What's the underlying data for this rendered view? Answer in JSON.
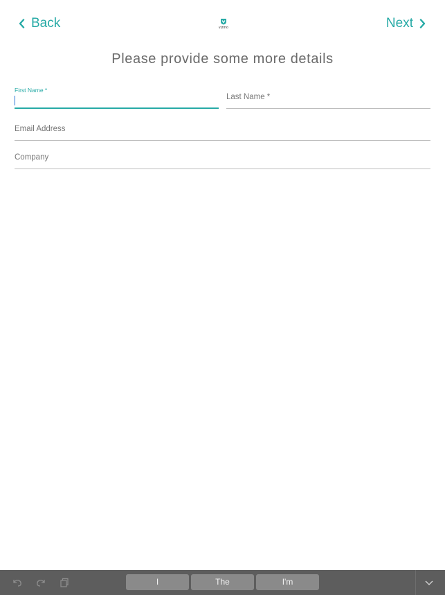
{
  "nav": {
    "back_label": "Back",
    "next_label": "Next",
    "logo_text": "vizmo"
  },
  "page": {
    "title": "Please provide some more details"
  },
  "form": {
    "first_name": {
      "label": "First Name *",
      "value": ""
    },
    "last_name": {
      "placeholder": "Last Name *",
      "value": ""
    },
    "email": {
      "placeholder": "Email Address",
      "value": ""
    },
    "company": {
      "placeholder": "Company",
      "value": ""
    }
  },
  "keyboard": {
    "suggestions": [
      "I",
      "The",
      "I'm"
    ]
  },
  "colors": {
    "accent": "#26aaa6",
    "text": "#666666",
    "underline": "#bdbdbd",
    "keyboard_bar": "#5d5d5d",
    "suggestion_bg": "#8a8a8a"
  },
  "icons": {
    "back": "chevron-left-icon",
    "next": "chevron-right-icon",
    "logo": "vizmo-logo-icon",
    "undo": "undo-icon",
    "redo": "redo-icon",
    "paste": "paste-icon",
    "dismiss": "keyboard-dismiss-icon"
  }
}
